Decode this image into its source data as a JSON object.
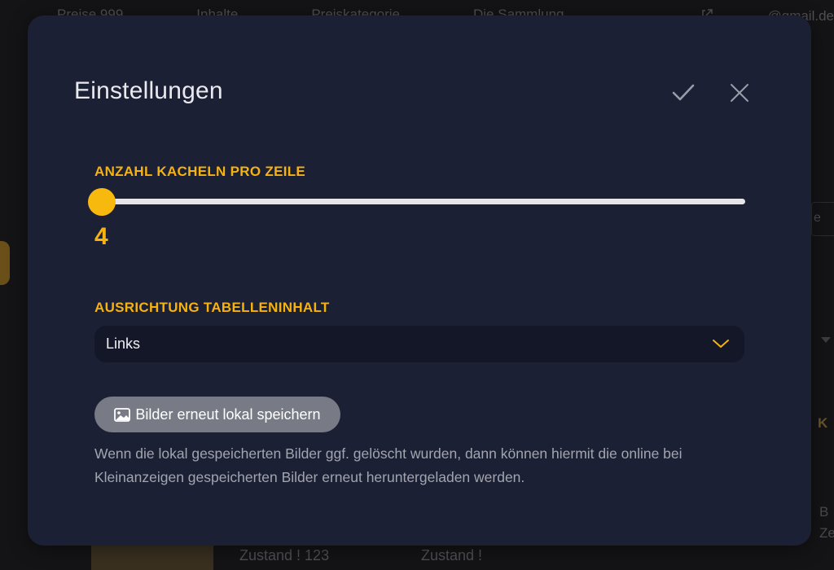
{
  "background": {
    "nav_items": [
      "Preise 999",
      "Inhalte",
      "Preiskategorie",
      "Die Sammlung"
    ],
    "email": "@gmail.de",
    "right_box_text": "e",
    "right_k_text": "K",
    "right_b_text": "B",
    "right_z_text": "Ze",
    "card_zustand_1": "Zustand ! 123",
    "card_zustand_2": "Zustand !"
  },
  "modal": {
    "title": "Einstellungen",
    "confirm_icon": "check-icon",
    "close_icon": "close-icon"
  },
  "tiles": {
    "label": "ANZAHL KACHELN PRO ZEILE",
    "value": "4",
    "fraction": 0.0
  },
  "alignment": {
    "label": "AUSRICHTUNG TABELLENINHALT",
    "selected": "Links",
    "chevron_icon": "chevron-down-icon"
  },
  "images": {
    "button_label": "Bilder erneut lokal speichern",
    "button_icon": "image-icon",
    "help_text": "Wenn die lokal gespeicherten Bilder ggf. gelöscht wurden, dann können hiermit die online bei Kleinanzeigen gespeicherten Bilder erneut heruntergeladen werden."
  },
  "colors": {
    "accent": "#f6b20f",
    "modal_bg": "#1c2035",
    "select_bg": "#141728",
    "button_bg": "#787b86"
  }
}
